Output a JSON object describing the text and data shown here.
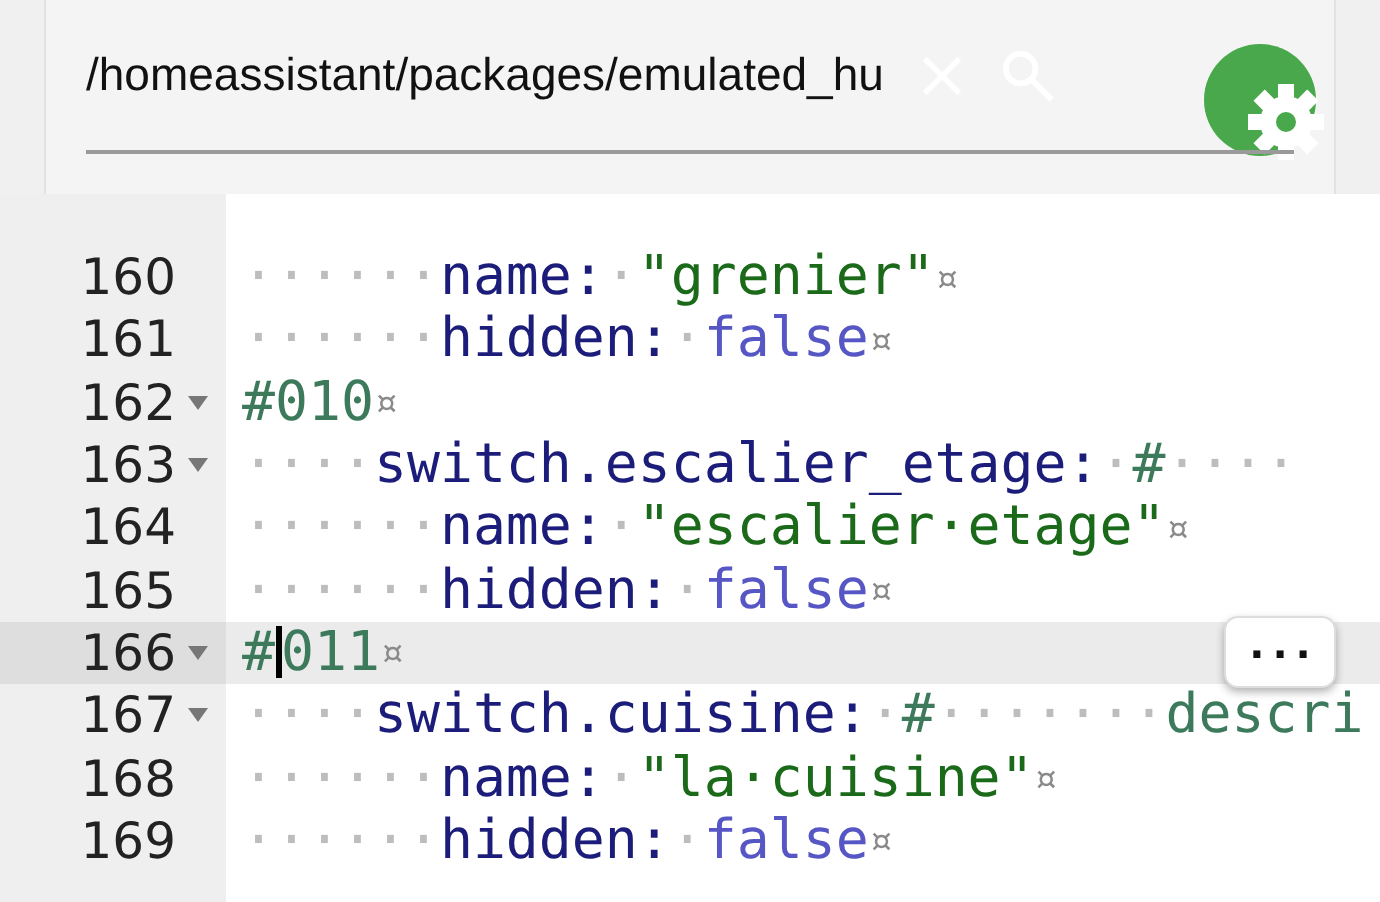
{
  "header": {
    "path": "/homeassistant/packages/emulated_hu"
  },
  "editor": {
    "lines": [
      {
        "number": "160",
        "foldable": false,
        "selected": false,
        "tokens": [
          {
            "kind": "ws",
            "text": "······"
          },
          {
            "kind": "key",
            "text": "name:"
          },
          {
            "kind": "ws",
            "text": "·"
          },
          {
            "kind": "string",
            "text": "\"grenier\""
          },
          {
            "kind": "eol",
            "text": "¤"
          }
        ]
      },
      {
        "number": "161",
        "foldable": false,
        "selected": false,
        "tokens": [
          {
            "kind": "ws",
            "text": "······"
          },
          {
            "kind": "key",
            "text": "hidden:"
          },
          {
            "kind": "ws",
            "text": "·"
          },
          {
            "kind": "bool",
            "text": "false"
          },
          {
            "kind": "eol",
            "text": "¤"
          }
        ]
      },
      {
        "number": "162",
        "foldable": true,
        "selected": false,
        "tokens": [
          {
            "kind": "comment",
            "text": "#010"
          },
          {
            "kind": "eol",
            "text": "¤"
          }
        ]
      },
      {
        "number": "163",
        "foldable": true,
        "selected": false,
        "tokens": [
          {
            "kind": "ws",
            "text": "····"
          },
          {
            "kind": "key",
            "text": "switch.escalier_etage:"
          },
          {
            "kind": "ws",
            "text": "·"
          },
          {
            "kind": "comment",
            "text": "#"
          },
          {
            "kind": "ws",
            "text": "····"
          }
        ]
      },
      {
        "number": "164",
        "foldable": false,
        "selected": false,
        "tokens": [
          {
            "kind": "ws",
            "text": "······"
          },
          {
            "kind": "key",
            "text": "name:"
          },
          {
            "kind": "ws",
            "text": "·"
          },
          {
            "kind": "string",
            "text": "\"escalier·etage\""
          },
          {
            "kind": "eol",
            "text": "¤"
          }
        ]
      },
      {
        "number": "165",
        "foldable": false,
        "selected": false,
        "tokens": [
          {
            "kind": "ws",
            "text": "······"
          },
          {
            "kind": "key",
            "text": "hidden:"
          },
          {
            "kind": "ws",
            "text": "·"
          },
          {
            "kind": "bool",
            "text": "false"
          },
          {
            "kind": "eol",
            "text": "¤"
          }
        ]
      },
      {
        "number": "166",
        "foldable": true,
        "selected": true,
        "tokens": [
          {
            "kind": "comment",
            "text": "#"
          },
          {
            "kind": "cursor"
          },
          {
            "kind": "comment",
            "text": "011"
          },
          {
            "kind": "eol",
            "text": "¤"
          }
        ]
      },
      {
        "number": "167",
        "foldable": true,
        "selected": false,
        "tokens": [
          {
            "kind": "ws",
            "text": "····"
          },
          {
            "kind": "key",
            "text": "switch.cuisine:"
          },
          {
            "kind": "ws",
            "text": "·"
          },
          {
            "kind": "comment",
            "text": "#"
          },
          {
            "kind": "ws",
            "text": "·······"
          },
          {
            "kind": "comment",
            "text": "descri"
          }
        ]
      },
      {
        "number": "168",
        "foldable": false,
        "selected": false,
        "tokens": [
          {
            "kind": "ws",
            "text": "······"
          },
          {
            "kind": "key",
            "text": "name:"
          },
          {
            "kind": "ws",
            "text": "·"
          },
          {
            "kind": "string",
            "text": "\"la·cuisine\""
          },
          {
            "kind": "eol",
            "text": "¤"
          }
        ]
      },
      {
        "number": "169",
        "foldable": false,
        "selected": false,
        "tokens": [
          {
            "kind": "ws",
            "text": "······"
          },
          {
            "kind": "key",
            "text": "hidden:"
          },
          {
            "kind": "ws",
            "text": "·"
          },
          {
            "kind": "bool",
            "text": "false"
          },
          {
            "kind": "eol",
            "text": "¤"
          }
        ]
      }
    ],
    "more_button": {
      "label": "..."
    }
  }
}
